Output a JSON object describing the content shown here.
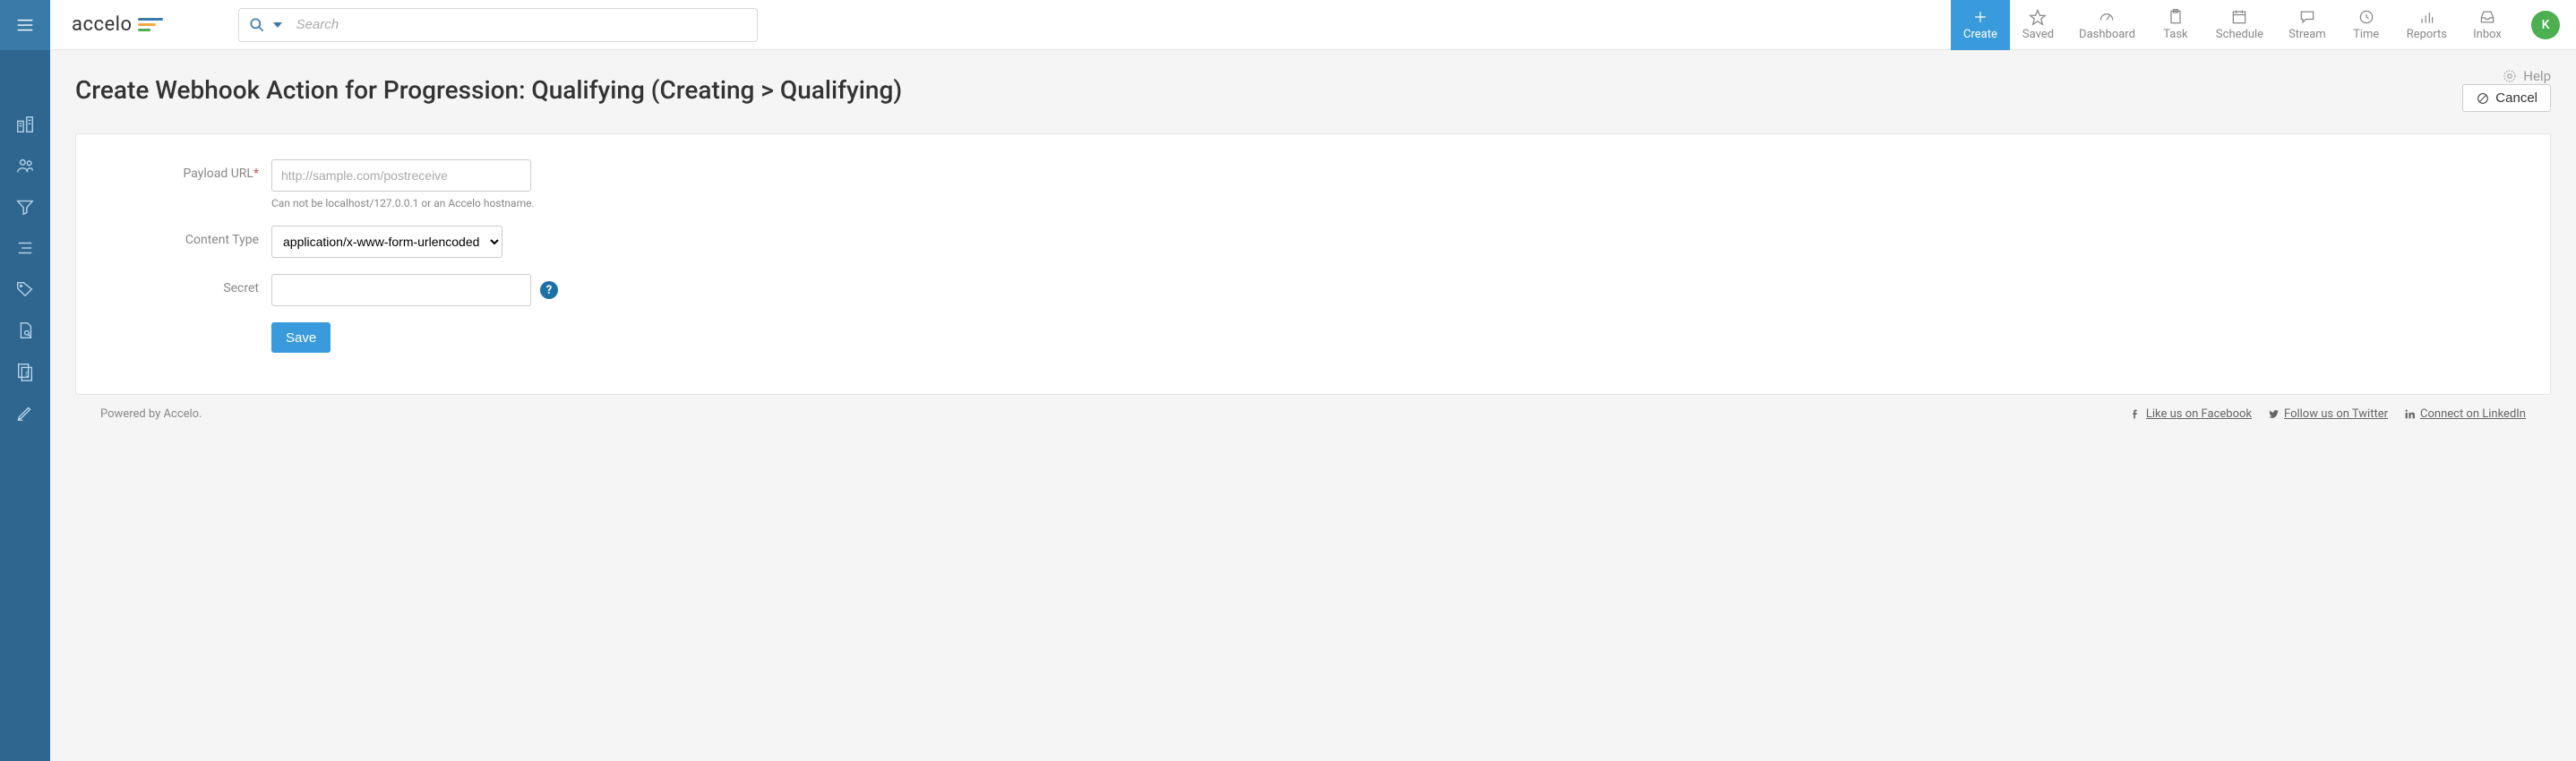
{
  "brand": "accelo",
  "search": {
    "placeholder": "Search"
  },
  "top_actions": {
    "create": "Create",
    "saved": "Saved",
    "dashboard": "Dashboard",
    "task": "Task",
    "schedule": "Schedule",
    "stream": "Stream",
    "time": "Time",
    "reports": "Reports",
    "inbox": "Inbox"
  },
  "avatar_initial": "K",
  "page": {
    "title": "Create Webhook Action for Progression: Qualifying (Creating > Qualifying)",
    "help_label": "Help",
    "cancel_label": "Cancel"
  },
  "form": {
    "payload_url": {
      "label": "Payload URL",
      "placeholder": "http://sample.com/postreceive",
      "hint": "Can not be localhost/127.0.0.1 or an Accelo hostname."
    },
    "content_type": {
      "label": "Content Type",
      "selected": "application/x-www-form-urlencoded"
    },
    "secret": {
      "label": "Secret"
    },
    "save_label": "Save"
  },
  "footer": {
    "powered": "Powered by Accelo.",
    "facebook": "Like us on Facebook",
    "twitter": "Follow us on Twitter",
    "linkedin": "Connect on LinkedIn"
  }
}
